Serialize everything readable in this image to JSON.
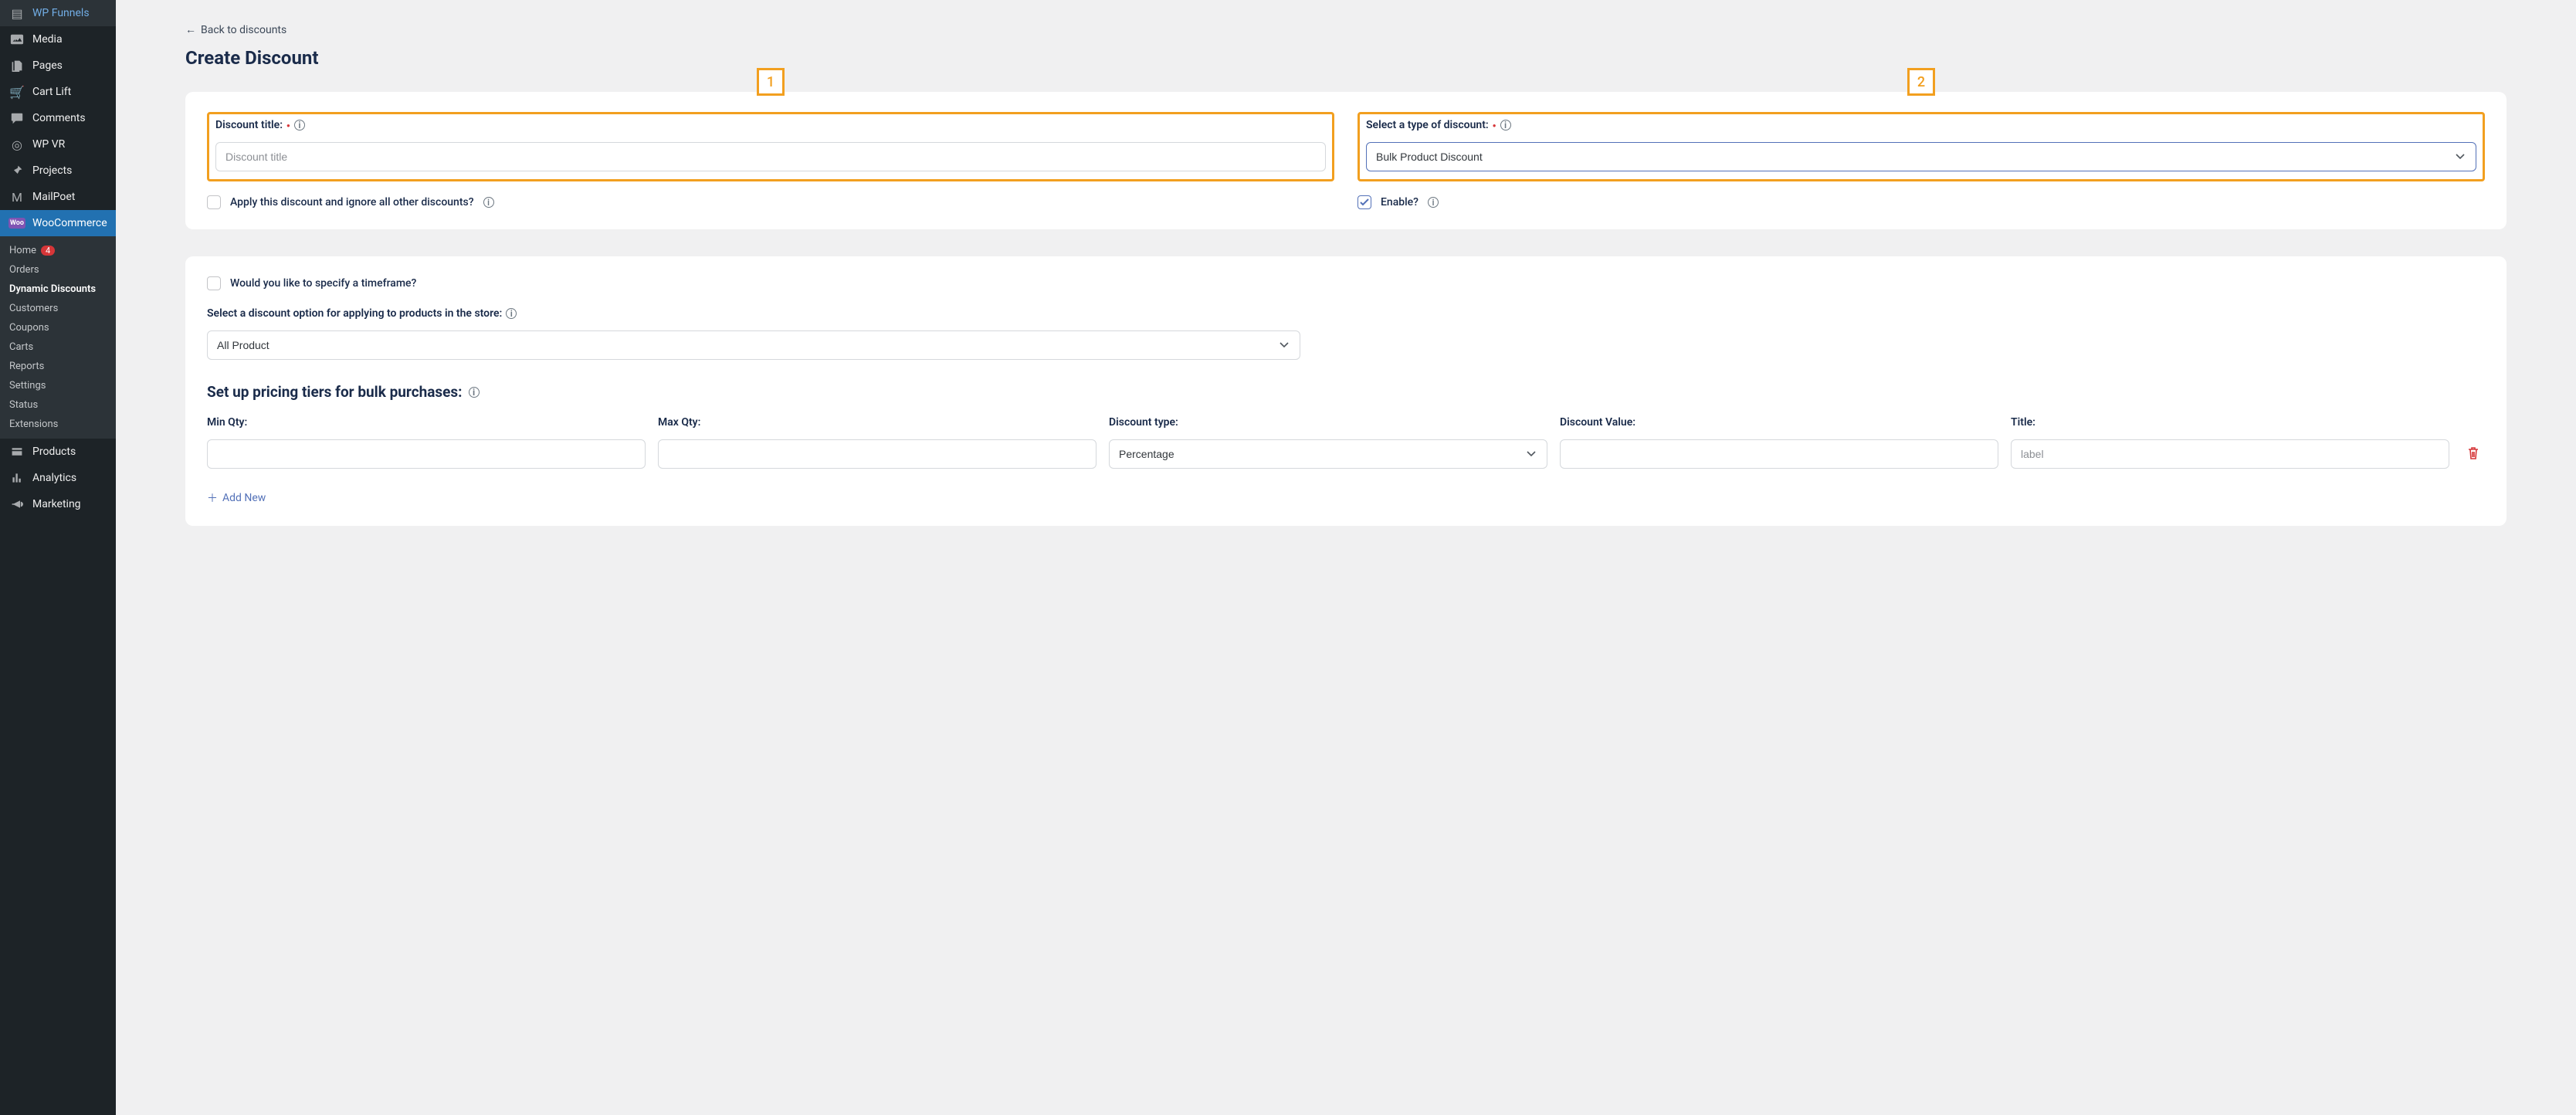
{
  "sidebar": {
    "items": [
      {
        "label": "WP Funnels",
        "icon": "funnel"
      },
      {
        "label": "Media",
        "icon": "media"
      },
      {
        "label": "Pages",
        "icon": "pages"
      },
      {
        "label": "Cart Lift",
        "icon": "cart"
      },
      {
        "label": "Comments",
        "icon": "comment"
      },
      {
        "label": "WP VR",
        "icon": "vr"
      },
      {
        "label": "Projects",
        "icon": "pin"
      },
      {
        "label": "MailPoet",
        "icon": "mail"
      }
    ],
    "active": {
      "label": "WooCommerce"
    },
    "submenu": {
      "home": "Home",
      "home_badge": "4",
      "orders": "Orders",
      "dynamic": "Dynamic Discounts",
      "customers": "Customers",
      "coupons": "Coupons",
      "carts": "Carts",
      "reports": "Reports",
      "settings": "Settings",
      "status": "Status",
      "extensions": "Extensions"
    },
    "tail": [
      {
        "label": "Products",
        "icon": "box"
      },
      {
        "label": "Analytics",
        "icon": "chart"
      },
      {
        "label": "Marketing",
        "icon": "horn"
      }
    ]
  },
  "page": {
    "back": "Back to discounts",
    "title": "Create Discount"
  },
  "markers": {
    "one": "1",
    "two": "2"
  },
  "card1": {
    "title_label": "Discount title:",
    "title_placeholder": "Discount title",
    "type_label": "Select a type of discount:",
    "type_value": "Bulk Product Discount",
    "apply_label": "Apply this discount and ignore all other discounts?",
    "enable_label": "Enable?"
  },
  "card2": {
    "timeframe_label": "Would you like to specify a timeframe?",
    "option_label": "Select a discount option for applying to products in the store:",
    "option_value": "All Product",
    "heading": "Set up pricing tiers for bulk purchases:",
    "tier": {
      "min": "Min Qty:",
      "max": "Max Qty:",
      "dtype": "Discount type:",
      "dval": "Discount Value:",
      "title": "Title:",
      "dtype_value": "Percentage",
      "title_placeholder": "label"
    },
    "add_new": "Add New"
  }
}
